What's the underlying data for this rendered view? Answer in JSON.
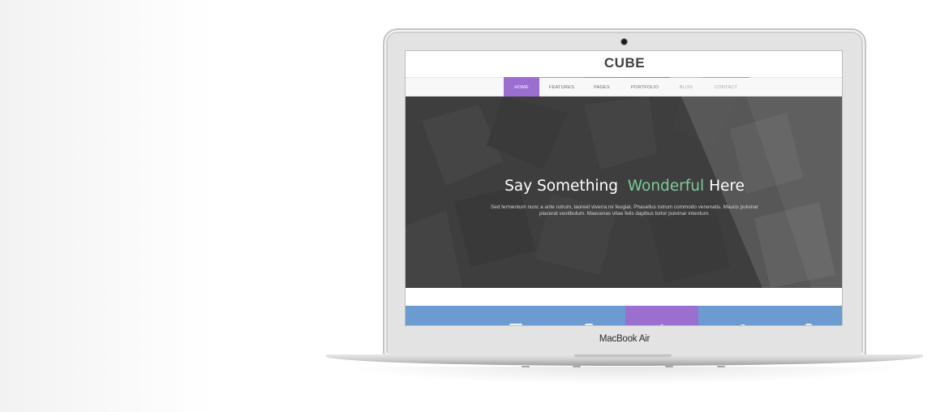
{
  "device": {
    "label": "MacBook Air"
  },
  "site": {
    "logo": "CUBE",
    "nav": [
      {
        "label": "HOME",
        "active": true,
        "underline": "#9a6fd0"
      },
      {
        "label": "FEATURES",
        "active": false,
        "underline": "#6fbf8a"
      },
      {
        "label": "PAGES",
        "active": false,
        "underline": "#e06a6a"
      },
      {
        "label": "PORTFOLIO",
        "active": false,
        "underline": "#5f8fd3"
      },
      {
        "label": "BLOG",
        "active": false,
        "underline": "#e8b94a"
      },
      {
        "label": "CONTACT",
        "active": false,
        "underline": "#e98a5a"
      }
    ],
    "hero": {
      "title_part1": "Say Something",
      "title_accent": "Wonderful",
      "title_part2": "Here",
      "subtitle_line1": "Sed fermentum nunc a ante rutrum, laoreet viverra mi feugiat. Phasellus rutrum commodo venenatis. Mauris pulvinar",
      "subtitle_line2": "placerat vestibulum. Maecenas vitae felis dapibus tortor pulvinar interdum."
    },
    "colors": {
      "accent_purple": "#9a6fd0",
      "accent_green": "#7ecb9b",
      "band_blue": "#6c9bd2",
      "hero_bg": "#3f3f3f"
    }
  }
}
